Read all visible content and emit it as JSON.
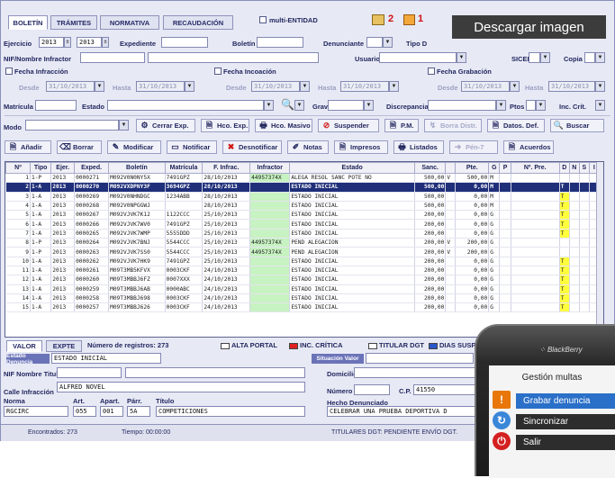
{
  "tabs": [
    "BOLETÍN",
    "TRÁMITES",
    "NORMATIVA",
    "RECAUDACIÓN"
  ],
  "multi_entidad": "multi-ENTIDAD",
  "badges": {
    "red_count": "2",
    "orange_count": "1"
  },
  "download_label": "Descargar imagen",
  "filters": {
    "ejercicio_label": "Ejercicio",
    "ejercicio_from": "2013",
    "ejercicio_to": "2013",
    "expediente_label": "Expediente",
    "boletin_label": "Boletín",
    "denunciante_label": "Denunciante",
    "tipo_label": "Tipo D",
    "nif_label": "NIF/Nombre Infractor",
    "usuario_label": "Usuario",
    "sicer_label": "SICER",
    "copia_label": "Copia",
    "fecha_infraccion": "Fecha Infracción",
    "fecha_incoacion": "Fecha Incoación",
    "fecha_grabacion": "Fecha Grabación",
    "desde": "Desde",
    "hasta": "Hasta",
    "date": "31/10/2013",
    "matricula_label": "Matrícula",
    "estado_label": "Estado",
    "grav_label": "Grav",
    "discrepancia_label": "Discrepancia",
    "ptos_label": "Ptos",
    "inc_crit_label": "Inc. Crít.",
    "modo_label": "Modo"
  },
  "toolbar1": [
    "Cerrar Exp.",
    "Hco. Exp.",
    "Hco. Masivo",
    "Suspender",
    "P.M.",
    "Borra Distr.",
    "Datos. Def.",
    "Buscar"
  ],
  "toolbar2": [
    "Añadir",
    "Borrar",
    "Modificar",
    "Notificar",
    "Desnotificar",
    "Notas",
    "Impresos",
    "Listados",
    "Pén-7",
    "Acuerdos"
  ],
  "columns": [
    "Nº",
    "Tipo",
    "Ejer.",
    "Exped.",
    "Boletín",
    "Matrícula",
    "F. Infrac.",
    "Infractor",
    "Estado",
    "Sanc.",
    "",
    "Pte.",
    "G",
    "P",
    "Nº. Pre.",
    "D",
    "N",
    "S",
    "I"
  ],
  "rows": [
    [
      "1",
      "1-P",
      "2013",
      "0000271",
      "M092V0N0NY5X",
      "7491GPZ",
      "28/10/2013",
      "44957374X",
      "ALEGA RESOL SANC POTE NO",
      "500,00",
      "V",
      "500,00",
      "M",
      "",
      "",
      "",
      "",
      "",
      ""
    ],
    [
      "2",
      "1-A",
      "2013",
      "0000270",
      "M092VXDPNY3F",
      "3694GPZ",
      "28/10/2013",
      "",
      "ESTADO INICIAL",
      "500,00",
      "",
      "0,00",
      "M",
      "",
      "",
      "T",
      "",
      "",
      ""
    ],
    [
      "3",
      "1-A",
      "2013",
      "0000269",
      "M092V0NHNDGC",
      "1234ABB",
      "28/10/2013",
      "",
      "ESTADO INICIAL",
      "500,00",
      "",
      "0,00",
      "M",
      "",
      "",
      "T",
      "",
      "",
      ""
    ],
    [
      "4",
      "1-A",
      "2013",
      "0000268",
      "M092V0NPGGWJ",
      "",
      "28/10/2013",
      "",
      "ESTADO INICIAL",
      "500,00",
      "",
      "0,00",
      "M",
      "",
      "",
      "T",
      "",
      "",
      ""
    ],
    [
      "5",
      "1-A",
      "2013",
      "0000267",
      "M092VJVK7K12",
      "1122CCC",
      "25/10/2013",
      "",
      "ESTADO INICIAL",
      "200,00",
      "",
      "0,00",
      "G",
      "",
      "",
      "T",
      "",
      "",
      ""
    ],
    [
      "6",
      "1-A",
      "2013",
      "0000266",
      "M092VJVK7WV0",
      "7491GPZ",
      "25/10/2013",
      "",
      "ESTADO INICIAL",
      "200,00",
      "",
      "0,00",
      "G",
      "",
      "",
      "T",
      "",
      "",
      ""
    ],
    [
      "7",
      "1-A",
      "2013",
      "0000265",
      "M092VJVK7WMP",
      "5555DDD",
      "25/10/2013",
      "",
      "ESTADO INICIAL",
      "200,00",
      "",
      "0,00",
      "G",
      "",
      "",
      "T",
      "",
      "",
      ""
    ],
    [
      "8",
      "1-P",
      "2013",
      "0000264",
      "M092VJVK7BNJ",
      "5544CCC",
      "25/10/2013",
      "44957374X",
      "PEND ALEGACION",
      "200,00",
      "V",
      "200,00",
      "G",
      "",
      "",
      "",
      "",
      "",
      ""
    ],
    [
      "9",
      "1-P",
      "2013",
      "0000263",
      "M092VJVK7SS0",
      "5544CCC",
      "25/10/2013",
      "44957374X",
      "PEND ALEGACION",
      "200,00",
      "V",
      "200,00",
      "G",
      "",
      "",
      "",
      "",
      "",
      ""
    ],
    [
      "10",
      "1-A",
      "2013",
      "0000262",
      "M092VJVK7HK9",
      "7491GPZ",
      "25/10/2013",
      "",
      "ESTADO INICIAL",
      "200,00",
      "",
      "0,00",
      "G",
      "",
      "",
      "T",
      "",
      "",
      ""
    ],
    [
      "11",
      "1-A",
      "2013",
      "0000261",
      "M09T3MB5KFVX",
      "0003CKF",
      "24/10/2013",
      "",
      "ESTADO INICIAL",
      "200,00",
      "",
      "0,00",
      "G",
      "",
      "",
      "T",
      "",
      "",
      ""
    ],
    [
      "12",
      "1-A",
      "2013",
      "0000260",
      "M09T3MBBJ6FZ",
      "0007XXX",
      "24/10/2013",
      "",
      "ESTADO INICIAL",
      "200,00",
      "",
      "0,00",
      "G",
      "",
      "",
      "T",
      "",
      "",
      ""
    ],
    [
      "13",
      "1-A",
      "2013",
      "0000259",
      "M09T3MBBJ6AB",
      "0000ABC",
      "24/10/2013",
      "",
      "ESTADO INICIAL",
      "200,00",
      "",
      "0,00",
      "G",
      "",
      "",
      "T",
      "",
      "",
      ""
    ],
    [
      "14",
      "1-A",
      "2013",
      "0000258",
      "M09T3MBBJ698",
      "0003CKF",
      "24/10/2013",
      "",
      "ESTADO INICIAL",
      "200,00",
      "",
      "0,00",
      "G",
      "",
      "",
      "T",
      "",
      "",
      ""
    ],
    [
      "15",
      "1-A",
      "2013",
      "0000257",
      "M09T3MBBJ626",
      "0003CKF",
      "24/10/2013",
      "",
      "ESTADO INICIAL",
      "200,00",
      "",
      "0,00",
      "G",
      "",
      "",
      "T",
      "",
      "",
      ""
    ]
  ],
  "bottom_tabs": [
    "VALOR",
    "EXPTE"
  ],
  "registros": "Número de registros: 273",
  "legend": [
    "ALTA PORTAL",
    "INC. CRÍTICA",
    "TITULAR DGT",
    "DIAS SUSPENSION"
  ],
  "detail": {
    "estado_denuncia_label": "Estado Denuncia",
    "estado_denuncia": "ESTADO INICIAL",
    "situacion_valor": "Situación Valor",
    "nif_titular_label": "NIF Nombre Titular",
    "domicilio_label": "Domicilio",
    "calle_label": "Calle Infracción",
    "calle": "ALFRED NOVEL",
    "numero_label": "Número",
    "cp_label": "C.P.",
    "cp": "41550",
    "norma_label": "Norma",
    "norma": "RGCIRC",
    "art_label": "Art.",
    "art": "055",
    "apart_label": "Apart.",
    "apart": "001",
    "parr_label": "Párr.",
    "parr": "5A",
    "titulo_label": "Título",
    "titulo": "COMPETICIONES",
    "hecho_label": "Hecho Denunciado",
    "hecho": "CELEBRAR UNA PRUEBA DEPORTIVA D"
  },
  "status": {
    "encontrados": "Encontrados: 273",
    "tiempo": "Tiempo: 00:00:00",
    "titulares": "TITULARES DGT: PENDIENTE ENVÍO DGT."
  },
  "phone": {
    "brand": "BlackBerry",
    "title": "Gestión multas",
    "items": [
      "Grabar denuncia",
      "Sincronizar",
      "Salir"
    ]
  }
}
